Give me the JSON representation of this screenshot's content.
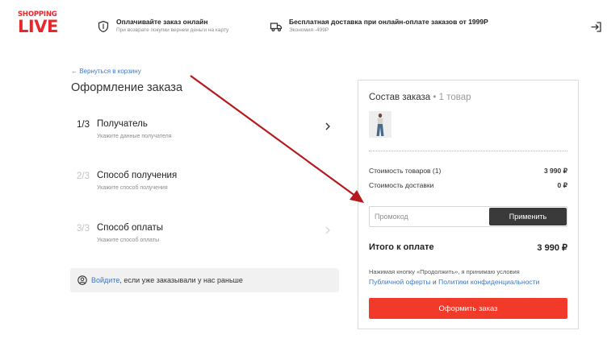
{
  "brand": {
    "logo_line1": "SHOPPING",
    "logo_line2": "LIVE",
    "color": "#e8262b"
  },
  "header": {
    "promos": [
      {
        "icon": "shield-icon",
        "title": "Оплачивайте заказ онлайн",
        "subtitle": "При возврате покупки вернем деньги на карту"
      },
      {
        "icon": "truck-icon",
        "title": "Бесплатная доставка при онлайн-оплате заказов от 1999Р",
        "subtitle": "Экономия -499Р"
      }
    ],
    "login_icon": "login-icon"
  },
  "checkout": {
    "back_link": "← Вернуться в корзину",
    "title": "Оформление заказа",
    "steps": [
      {
        "num": "1/3",
        "name": "Получатель",
        "hint": "Укажите данные получателя",
        "active": true
      },
      {
        "num": "2/3",
        "name": "Способ получения",
        "hint": "Укажите способ получения",
        "active": false
      },
      {
        "num": "3/3",
        "name": "Способ оплаты",
        "hint": "Укажите способ оплаты",
        "active": false
      }
    ],
    "login_banner": {
      "link": "Войдите",
      "text": ", если уже заказывали у нас раньше"
    }
  },
  "order_summary": {
    "title": "Состав заказа",
    "separator": " • ",
    "count": "1 товар",
    "rows": [
      {
        "label": "Стоимость товаров (1)",
        "value": "3 990 ₽"
      },
      {
        "label": "Стоимость доставки",
        "value": "0 ₽"
      }
    ],
    "promo": {
      "placeholder": "Промокод",
      "value": "",
      "apply_label": "Применить"
    },
    "total": {
      "label": "Итого к оплате",
      "value": "3 990 ₽"
    },
    "terms": {
      "text": "Нажимая кнопку «Продолжить», я принимаю условия",
      "link1": "Публичной оферты",
      "and": " и ",
      "link2": "Политики конфиденциальности"
    },
    "checkout_label": "Оформить заказ"
  },
  "colors": {
    "accent": "#f23a2b",
    "link": "#3f78c8",
    "dark_button": "#3a3a3a",
    "annotation_arrow": "#b5191e"
  }
}
